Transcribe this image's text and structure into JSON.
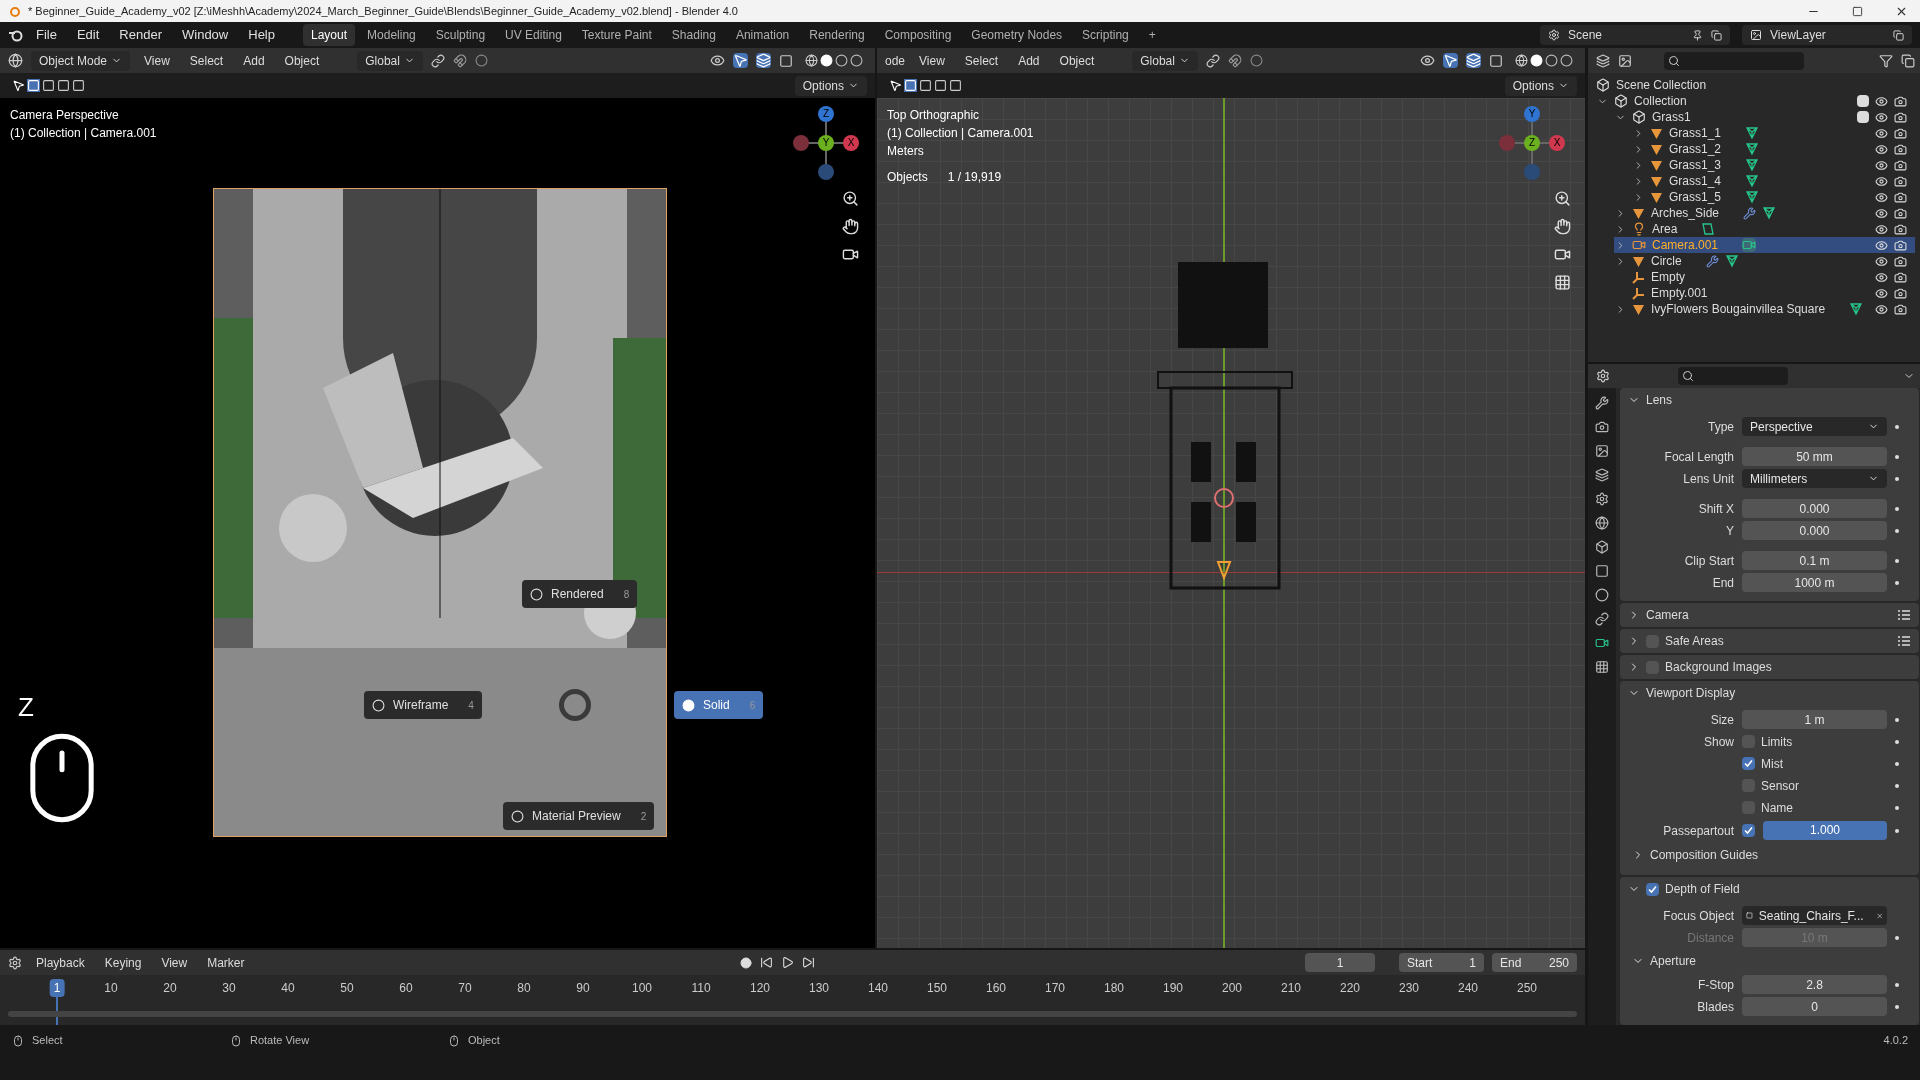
{
  "window": {
    "title": "* Beginner_Guide_Academy_v02 [Z:\\iMeshh\\Academy\\2024_March_Beginner_Guide\\Blends\\Beginner_Guide_Academy_v02.blend] - Blender 4.0"
  },
  "menu": [
    "File",
    "Edit",
    "Render",
    "Window",
    "Help"
  ],
  "workspaces": [
    {
      "label": "Layout",
      "selected": true
    },
    {
      "label": "Modeling",
      "selected": false
    },
    {
      "label": "Sculpting",
      "selected": false
    },
    {
      "label": "UV Editing",
      "selected": false
    },
    {
      "label": "Texture Paint",
      "selected": false
    },
    {
      "label": "Shading",
      "selected": false
    },
    {
      "label": "Animation",
      "selected": false
    },
    {
      "label": "Rendering",
      "selected": false
    },
    {
      "label": "Compositing",
      "selected": false
    },
    {
      "label": "Geometry Nodes",
      "selected": false
    },
    {
      "label": "Scripting",
      "selected": false
    },
    {
      "label": "+",
      "selected": false
    }
  ],
  "scene": "Scene",
  "view_layer": "ViewLayer",
  "left_viewport": {
    "mode": "Object Mode",
    "menus": [
      "View",
      "Select",
      "Add",
      "Object"
    ],
    "orientation": "Global",
    "options": "Options",
    "info": [
      "Camera Perspective",
      "(1) Collection | Camera.001"
    ],
    "gizmo": [
      "Z",
      "Y",
      "X"
    ],
    "key_hint": "Z",
    "pie_menu": [
      {
        "label": "Rendered",
        "shortcut": "8",
        "selected": false
      },
      {
        "label": "Wireframe",
        "shortcut": "4",
        "selected": false
      },
      {
        "label": "Solid",
        "shortcut": "6",
        "selected": true
      },
      {
        "label": "Material Preview",
        "shortcut": "2",
        "selected": false
      }
    ]
  },
  "right_viewport": {
    "mode": "ode",
    "menus": [
      "View",
      "Select",
      "Add",
      "Object"
    ],
    "orientation": "Global",
    "options": "Options",
    "info": [
      "Top Orthographic",
      "(1) Collection | Camera.001",
      "Meters"
    ],
    "stats_label": "Objects",
    "stats_value": "1 / 19,919",
    "gizmo": [
      "Y",
      "Z",
      "X"
    ]
  },
  "outliner": {
    "root": "Scene Collection",
    "tree": [
      {
        "name": "Collection",
        "kind": "collection",
        "expanded": true,
        "checked": true,
        "selected": false,
        "children": [
          {
            "name": "Grass1",
            "kind": "collection",
            "expanded": true,
            "checked": true,
            "selected": false,
            "children": [
              {
                "name": "Grass1_1",
                "kind": "mesh",
                "expanded": false,
                "selected": false,
                "modifier": false
              },
              {
                "name": "Grass1_2",
                "kind": "mesh",
                "expanded": false,
                "selected": false,
                "modifier": false
              },
              {
                "name": "Grass1_3",
                "kind": "mesh",
                "expanded": false,
                "selected": false,
                "modifier": false
              },
              {
                "name": "Grass1_4",
                "kind": "mesh",
                "expanded": false,
                "selected": false,
                "modifier": false
              },
              {
                "name": "Grass1_5",
                "kind": "mesh",
                "expanded": false,
                "selected": false,
                "modifier": false
              }
            ]
          },
          {
            "name": "Arches_Side",
            "kind": "mesh",
            "expanded": false,
            "selected": false,
            "modifier": true
          },
          {
            "name": "Area",
            "kind": "light",
            "expanded": false,
            "selected": false,
            "modifier": false
          },
          {
            "name": "Camera.001",
            "kind": "camera",
            "expanded": false,
            "selected": true,
            "modifier": false
          },
          {
            "name": "Circle",
            "kind": "mesh",
            "expanded": false,
            "selected": false,
            "modifier": true
          },
          {
            "name": "Empty",
            "kind": "empty",
            "selected": false
          },
          {
            "name": "Empty.001",
            "kind": "empty",
            "selected": false
          },
          {
            "name": "IvyFlowers Bougainvillea Square",
            "kind": "mesh",
            "expanded": false,
            "selected": false
          }
        ]
      }
    ]
  },
  "properties": {
    "sections": [
      {
        "title": "Lens",
        "expanded": true,
        "rows": [
          {
            "kind": "dropdown",
            "label": "Type",
            "value": "Perspective"
          },
          {
            "kind": "number",
            "label": "Focal Length",
            "value": "50 mm",
            "gap": true
          },
          {
            "kind": "dropdown",
            "label": "Lens Unit",
            "value": "Millimeters"
          },
          {
            "kind": "number",
            "label": "Shift X",
            "value": "0.000",
            "gap": true
          },
          {
            "kind": "number",
            "label": "Y",
            "value": "0.000"
          },
          {
            "kind": "number",
            "label": "Clip Start",
            "value": "0.1 m",
            "gap": true
          },
          {
            "kind": "number",
            "label": "End",
            "value": "1000 m"
          }
        ]
      },
      {
        "title": "Camera",
        "expanded": false,
        "presets": true
      },
      {
        "title": "Safe Areas",
        "expanded": false,
        "checked": false,
        "presets": true
      },
      {
        "title": "Background Images",
        "expanded": false,
        "checked": false
      },
      {
        "title": "Viewport Display",
        "expanded": true,
        "rows": [
          {
            "kind": "number",
            "label": "Size",
            "value": "1 m"
          },
          {
            "kind": "checkbox",
            "label": "Show",
            "text": "Limits",
            "checked": false
          },
          {
            "kind": "checkbox",
            "text": "Mist",
            "checked": true
          },
          {
            "kind": "checkbox",
            "text": "Sensor",
            "checked": false
          },
          {
            "kind": "checkbox",
            "text": "Name",
            "checked": false
          },
          {
            "kind": "check_slider",
            "label": "Passepartout",
            "checked": true,
            "value": "1.000",
            "level": 1
          },
          {
            "kind": "subpanel",
            "title": "Composition Guides",
            "expanded": false
          }
        ]
      },
      {
        "title": "Depth of Field",
        "expanded": true,
        "checked": true,
        "rows": [
          {
            "kind": "object",
            "label": "Focus Object",
            "value": "Seating_Chairs_F..."
          },
          {
            "kind": "number",
            "label": "Distance",
            "value": "10 m",
            "disabled": true
          },
          {
            "kind": "subpanel",
            "title": "Aperture",
            "expanded": true
          },
          {
            "kind": "number",
            "label": "F-Stop",
            "value": "2.8"
          },
          {
            "kind": "number",
            "label": "Blades",
            "value": "0"
          }
        ]
      }
    ]
  },
  "timeline": {
    "menus": [
      "Playback",
      "Keying",
      "View",
      "Marker"
    ],
    "current_frame": "1",
    "start_label": "Start",
    "start": "1",
    "end_label": "End",
    "end": "250",
    "ticks": [
      {
        "label": "1",
        "selected": true
      },
      {
        "label": "10",
        "selected": false
      },
      {
        "label": "20",
        "selected": false
      },
      {
        "label": "30",
        "selected": false
      },
      {
        "label": "40",
        "selected": false
      },
      {
        "label": "50",
        "selected": false
      },
      {
        "label": "60",
        "selected": false
      },
      {
        "label": "70",
        "selected": false
      },
      {
        "label": "80",
        "selected": false
      },
      {
        "label": "90",
        "selected": false
      },
      {
        "label": "100",
        "selected": false
      },
      {
        "label": "110",
        "selected": false
      },
      {
        "label": "120",
        "selected": false
      },
      {
        "label": "130",
        "selected": false
      },
      {
        "label": "140",
        "selected": false
      },
      {
        "label": "150",
        "selected": false
      },
      {
        "label": "160",
        "selected": false
      },
      {
        "label": "170",
        "selected": false
      },
      {
        "label": "180",
        "selected": false
      },
      {
        "label": "190",
        "selected": false
      },
      {
        "label": "200",
        "selected": false
      },
      {
        "label": "210",
        "selected": false
      },
      {
        "label": "220",
        "selected": false
      },
      {
        "label": "230",
        "selected": false
      },
      {
        "label": "240",
        "selected": false
      },
      {
        "label": "250",
        "selected": false
      }
    ]
  },
  "status_bar": {
    "hints": [
      "Select",
      "Rotate View",
      "Object"
    ],
    "version": "4.0.2"
  }
}
